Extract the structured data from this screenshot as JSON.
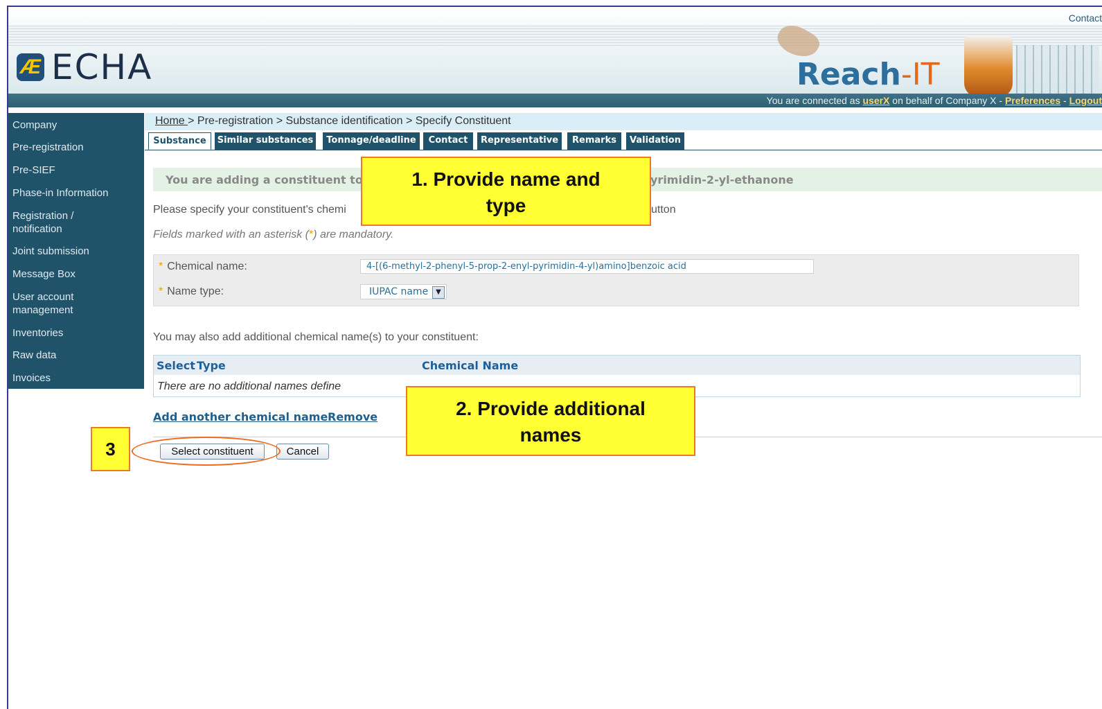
{
  "header": {
    "contact": "Contact",
    "logo_text": "ECHA",
    "logo_mark": "Æ",
    "app_name_a": "Reach",
    "app_name_b": "-IT",
    "conn_prefix": "You are connected as ",
    "user": "userX",
    "conn_mid": " on behalf of Company X - ",
    "preferences": "Preferences",
    "dash": " - ",
    "logout": "Logout"
  },
  "sidebar": {
    "items": [
      {
        "label": "Company"
      },
      {
        "label": "Pre-registration"
      },
      {
        "label": "Pre-SIEF"
      },
      {
        "label": "Phase-in Information"
      },
      {
        "label": "Registration /"
      },
      {
        "label": "notification"
      },
      {
        "label": "Joint submission"
      },
      {
        "label": "Message Box"
      },
      {
        "label": "User account"
      },
      {
        "label": "management"
      },
      {
        "label": "Inventories"
      },
      {
        "label": "Raw data"
      },
      {
        "label": "Invoices"
      }
    ]
  },
  "breadcrumb": {
    "home": "Home ",
    "rest": "> Pre-registration > Substance identification > Specify Constituent"
  },
  "tabs": [
    {
      "label": "Substance"
    },
    {
      "label": "Similar substances"
    },
    {
      "label": "Tonnage/deadline"
    },
    {
      "label": "Contact"
    },
    {
      "label": "Representative"
    },
    {
      "label": "Remarks"
    },
    {
      "label": "Validation"
    }
  ],
  "main": {
    "adding_prefix": "You are adding a constituent to: I",
    "adding_suffix": "yrimidin-2-yl-ethanone",
    "instruction_a": "Please specify your constituent's chemi",
    "instruction_b": "utton",
    "mandatory_a": "Fields marked with an asterisk (",
    "asterisk": "*",
    "mandatory_b": ") are mandatory.",
    "chem_name_label": "Chemical name:",
    "chem_name_value": "4-[(6-methyl-2-phenyl-5-prop-2-enyl-pyrimidin-4-yl)amino]benzoic acid",
    "name_type_label": "Name type:",
    "name_type_value": "IUPAC name",
    "additional_text": "You may also add additional chemical name(s) to your constituent:",
    "table": {
      "headers": [
        "Select",
        "Type",
        "Chemical Name"
      ],
      "empty_row": "There are no additional names define"
    },
    "add_link": "Add another chemical name",
    "remove_link": "Remove",
    "select_button": "Select constituent",
    "cancel_button": "Cancel"
  },
  "callouts": {
    "c1_line1": "1. Provide name and",
    "c1_line2": "type",
    "c2_line1": "2. Provide additional",
    "c2_line2": "names",
    "c3": "3"
  },
  "colors": {
    "sidebar_bg": "#20536a",
    "callout_fill": "#ffff33",
    "callout_border": "#f07a1e",
    "link": "#1f5f8e"
  }
}
